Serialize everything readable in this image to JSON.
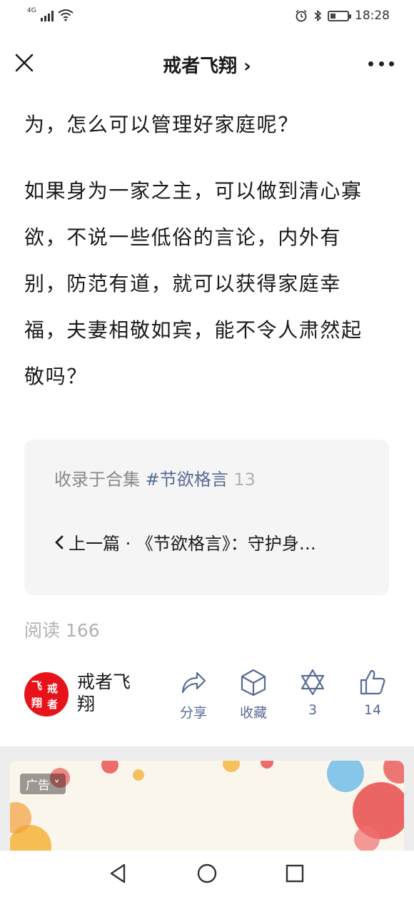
{
  "status_bar": {
    "network": "4G",
    "time": "18:28",
    "battery_level": 0.3
  },
  "nav": {
    "title": "戒者飞翔 ›"
  },
  "article": {
    "lines_para1": [
      "为，怎么可以管理好家庭呢？"
    ],
    "lines_para2": [
      "如果身为一家之主，可以做到清心寡",
      "欲，不说一些低俗的言论，内外有",
      "别，防范有道，就可以获得家庭幸",
      "福，夫妻相敬如宾，能不令人肃然起",
      "敬吗？"
    ]
  },
  "collection": {
    "prefix": "收录于合集 ",
    "tag": "#节欲格言",
    "count": " 13",
    "prev_label": "上一篇 · 《节欲格言》：守护身…"
  },
  "stats": {
    "read_count": "阅读 166"
  },
  "author": {
    "name": "戒者飞翔",
    "avatar_chars": [
      "飞",
      "戒",
      "翔",
      "者"
    ]
  },
  "actions": {
    "share": "分享",
    "favorite": "收藏",
    "wow": "3",
    "like": "14"
  },
  "ad": {
    "badge": "广告"
  },
  "colors": {
    "link_blue": "#576b95",
    "muted_gray": "#b2b2b2",
    "avatar_red": "#e8131a"
  },
  "icons": [
    "close-icon",
    "more-icon",
    "share-icon",
    "favorite-icon",
    "wow-icon",
    "like-icon",
    "back-icon",
    "home-icon",
    "recents-icon"
  ]
}
